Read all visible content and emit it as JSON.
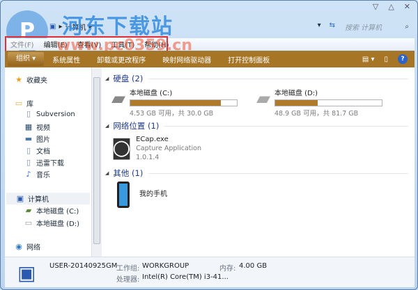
{
  "window": {
    "caption_buttons": [
      "▽",
      "△",
      "✕"
    ]
  },
  "address": {
    "path": "计算机",
    "search_placeholder": "搜索 计算机"
  },
  "watermark": {
    "site_name": "河东下载站",
    "url": "www.pc0359.cn"
  },
  "menu": [
    "文件(F)",
    "编辑(E)",
    "查看(V)",
    "工具(T)",
    "帮助(H)"
  ],
  "toolbar": {
    "organize": "组织 ▾",
    "items": [
      "系统属性",
      "卸载或更改程序",
      "映射网络驱动器",
      "打开控制面板"
    ]
  },
  "nav": {
    "favorites": "收藏夹",
    "libraries": "库",
    "library_items": [
      "Subversion",
      "视频",
      "图片",
      "文档",
      "迅雷下载",
      "音乐"
    ],
    "computer": "计算机",
    "drives": [
      "本地磁盘 (C:)",
      "本地磁盘 (D:)"
    ],
    "network": "网络"
  },
  "groups": {
    "hdd": "硬盘 (2)",
    "netloc": "网络位置 (1)",
    "other": "其他 (1)"
  },
  "drives": [
    {
      "name": "本地磁盘 (C:)",
      "info": "4.53 GB 可用，共 30.0 GB",
      "used_fraction": 0.849
    },
    {
      "name": "本地磁盘 (D:)",
      "info": "48.9 GB 可用，共 81.7 GB",
      "used_fraction": 0.401
    }
  ],
  "netloc": {
    "name": "ECap.exe",
    "desc": "Capture Application",
    "version": "1.0.1.4"
  },
  "other": {
    "name": "我的手机"
  },
  "status": {
    "computer_name": "USER-20140925GM",
    "workgroup_label": "工作组:",
    "workgroup": "WORKGROUP",
    "memory_label": "内存:",
    "memory": "4.00 GB",
    "cpu_label": "处理器:",
    "cpu": "Intel(R) Core(TM) i3-41..."
  },
  "colors": {
    "toolbar": "#a67626",
    "bar_fill": "#b07a2b",
    "group_header": "#1e3a8a"
  }
}
